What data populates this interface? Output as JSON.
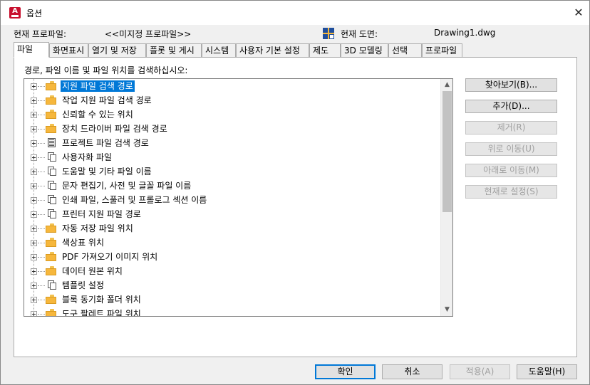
{
  "window": {
    "title": "옵션",
    "app_icon_letter": "A",
    "close_symbol": "✕"
  },
  "profile": {
    "current_profile_label": "현재 프로파일:",
    "current_profile_value": "<<미지정 프로파일>>",
    "current_drawing_label": "현재 도면:",
    "current_drawing_value": "Drawing1.dwg",
    "drawing_icon": "drawing-file-icon"
  },
  "tabs": [
    {
      "label": "파일",
      "active": true
    },
    {
      "label": "화면표시"
    },
    {
      "label": "열기 및 저장"
    },
    {
      "label": "플롯 및 게시"
    },
    {
      "label": "시스템"
    },
    {
      "label": "사용자 기본 설정"
    },
    {
      "label": "제도"
    },
    {
      "label": "3D 모델링"
    },
    {
      "label": "선택"
    },
    {
      "label": "프로파일"
    }
  ],
  "panel": {
    "instruction": "경로, 파일 이름 및 파일 위치를 검색하십시오:"
  },
  "tree": {
    "items": [
      {
        "label": "지원 파일 검색 경로",
        "icon": "folder-icon",
        "selected": true
      },
      {
        "label": "작업 지원 파일 검색 경로",
        "icon": "folder-icon"
      },
      {
        "label": "신뢰할 수 있는 위치",
        "icon": "folder-icon"
      },
      {
        "label": "장치 드라이버 파일 검색 경로",
        "icon": "folder-icon"
      },
      {
        "label": "프로젝트 파일 검색 경로",
        "icon": "project-icon"
      },
      {
        "label": "사용자화 파일",
        "icon": "documents-icon"
      },
      {
        "label": "도움말 및 기타 파일 이름",
        "icon": "documents-icon"
      },
      {
        "label": "문자 편집기, 사전 및 글꼴 파일 이름",
        "icon": "documents-icon"
      },
      {
        "label": "인쇄 파일, 스풀러 및 프롤로그 섹션 이름",
        "icon": "documents-icon"
      },
      {
        "label": "프린터 지원 파일 경로",
        "icon": "documents-icon"
      },
      {
        "label": "자동 저장 파일 위치",
        "icon": "folder-icon"
      },
      {
        "label": "색상표 위치",
        "icon": "folder-icon"
      },
      {
        "label": "PDF 가져오기 이미지 위치",
        "icon": "folder-icon"
      },
      {
        "label": "데이터 원본 위치",
        "icon": "folder-icon"
      },
      {
        "label": "템플릿 설정",
        "icon": "documents-icon"
      },
      {
        "label": "블록 동기화 폴더 위치",
        "icon": "folder-icon"
      },
      {
        "label": "도구 팔레트 파일 위치",
        "icon": "folder-icon"
      }
    ]
  },
  "side_buttons": [
    {
      "label": "찾아보기(B)...",
      "enabled": true
    },
    {
      "label": "추가(D)...",
      "enabled": true
    },
    {
      "label": "제거(R)",
      "enabled": false
    },
    {
      "label": "위로 이동(U)",
      "enabled": false
    },
    {
      "label": "아래로 이동(M)",
      "enabled": false
    },
    {
      "label": "현재로 설정(S)",
      "enabled": false
    }
  ],
  "bottom_buttons": {
    "ok": "확인",
    "cancel": "취소",
    "apply": "적용(A)",
    "help": "도움말(H)"
  },
  "colors": {
    "selection": "#0078d7",
    "folder": "#f6b73c"
  }
}
